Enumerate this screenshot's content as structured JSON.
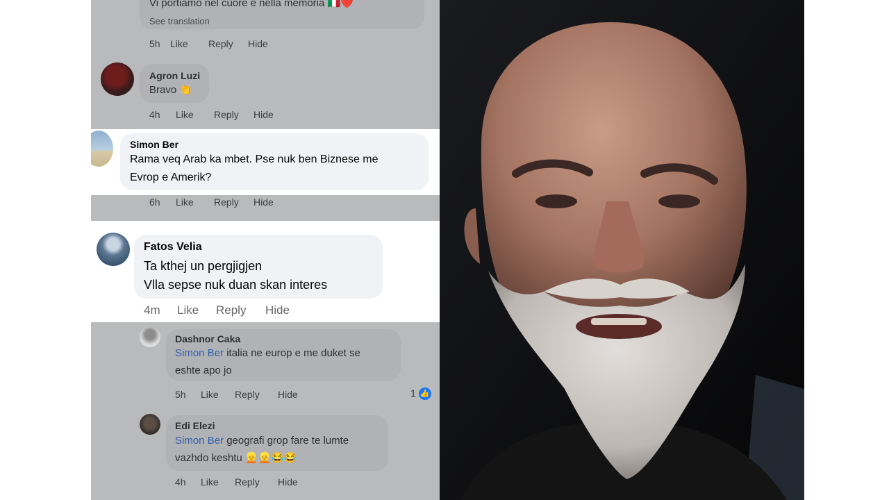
{
  "comment_top": {
    "text": "Vi portiamo nel cuore e nella memoria",
    "flags": "🇮🇹❤️",
    "see_translation": "See translation",
    "time": "5h",
    "like": "Like",
    "reply": "Reply",
    "hide": "Hide"
  },
  "comments": [
    {
      "name": "Agron Luzi",
      "text": "Bravo 👏",
      "time": "4h",
      "like": "Like",
      "reply": "Reply",
      "hide": "Hide"
    },
    {
      "name": "Simon Ber",
      "text_line1": "Rama veq Arab ka mbet. Pse nuk ben Biznese me",
      "text_line2": "Evrop e Amerik?",
      "time": "6h",
      "like": "Like",
      "reply": "Reply",
      "hide": "Hide"
    },
    {
      "name": "Fatos Velia",
      "text_line1": "Ta kthej  un pergjigjen",
      "text_line2": "Vlla sepse nuk  duan  skan interes",
      "time": "4m",
      "like": "Like",
      "reply": "Reply",
      "hide": "Hide"
    }
  ],
  "replies": [
    {
      "name": "Dashnor Caka",
      "mention": "Simon Ber",
      "text_line1": " italia ne europ e me duket se",
      "text_line2": "eshte apo jo",
      "time": "5h",
      "like": "Like",
      "reply": "Reply",
      "hide": "Hide",
      "reactions": "1"
    },
    {
      "name": "Edi Elezi",
      "mention": "Simon Ber",
      "text_line1": " geografi grop fare te lumte",
      "text_line2": "vazhdo keshtu 👱👱😂😂",
      "time": "4h",
      "like": "Like",
      "reply": "Reply",
      "hide": "Hide"
    }
  ],
  "colors": {
    "highlight": "#ffffff",
    "dimmed_bg": "#b9babc",
    "mention": "#2f5fae",
    "like_badge": "#1877f2"
  }
}
